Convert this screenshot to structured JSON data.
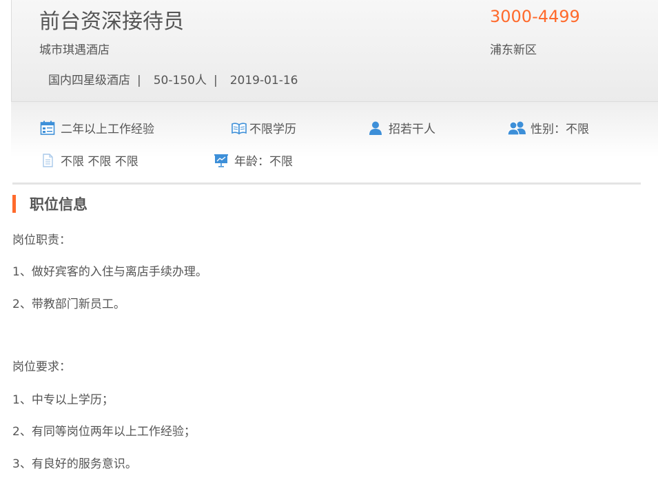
{
  "header": {
    "job_title": "前台资深接待员",
    "company": "城市琪遇酒店",
    "hotel_type": "国内四星级酒店",
    "company_size": "50-150人",
    "post_date": "2019-01-16",
    "separator": "|",
    "salary": "3000-4499",
    "district": "浦东新区"
  },
  "attributes": {
    "experience": "二年以上工作经验",
    "education": "不限学历",
    "headcount": "招若干人",
    "gender": "性别：不限",
    "misc": "不限 不限 不限",
    "age": "年龄：不限"
  },
  "section": {
    "title": "职位信息",
    "lines": [
      "岗位职责：",
      "1、做好宾客的入住与离店手续办理。",
      "2、带教部门新员工。",
      " 岗位要求：",
      "1、中专以上学历；",
      "2、有同等岗位两年以上工作经验；",
      "3、有良好的服务意识。"
    ]
  },
  "colors": {
    "accent": "#ff6a2c",
    "icon_blue": "#3d8fd8",
    "text": "#555555"
  },
  "icons": {
    "experience": "calendar-icon",
    "education": "book-icon",
    "headcount": "person-icon",
    "gender": "people-icon",
    "misc": "document-icon",
    "age": "presentation-icon"
  }
}
